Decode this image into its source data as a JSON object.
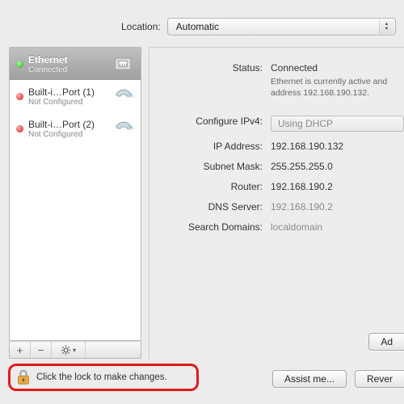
{
  "location": {
    "label": "Location:",
    "value": "Automatic"
  },
  "sidebar": {
    "services": [
      {
        "name": "Ethernet",
        "state": "Connected",
        "status": "green",
        "icon": "ethernet",
        "selected": true
      },
      {
        "name": "Built-i…Port (1)",
        "state": "Not Configured",
        "status": "red",
        "icon": "phone",
        "selected": false
      },
      {
        "name": "Built-i…Port (2)",
        "state": "Not Configured",
        "status": "red",
        "icon": "phone",
        "selected": false
      }
    ],
    "buttons": {
      "add": "+",
      "remove": "−"
    }
  },
  "detail": {
    "status_key": "Status:",
    "status_value": "Connected",
    "status_desc": "Ethernet is currently active and address 192.168.190.132.",
    "configure_key": "Configure IPv4:",
    "configure_value": "Using DHCP",
    "ip_key": "IP Address:",
    "ip_value": "192.168.190.132",
    "subnet_key": "Subnet Mask:",
    "subnet_value": "255.255.255.0",
    "router_key": "Router:",
    "router_value": "192.168.190.2",
    "dns_key": "DNS Server:",
    "dns_value": "192.168.190.2",
    "search_key": "Search Domains:",
    "search_value": "localdomain",
    "advanced_button": "Ad"
  },
  "lock": {
    "text": "Click the lock to make changes."
  },
  "footer": {
    "assist": "Assist me...",
    "revert": "Rever"
  }
}
